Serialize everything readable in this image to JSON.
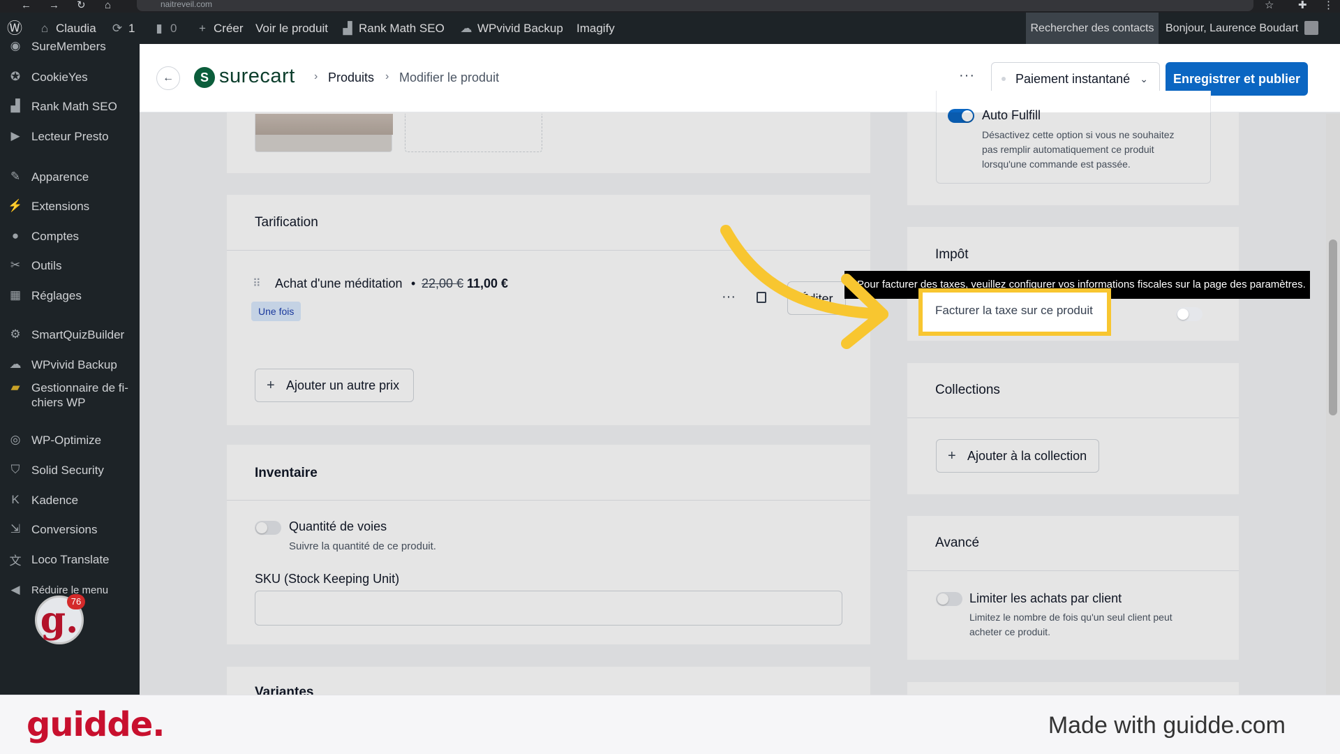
{
  "browser": {
    "url": "naitreveil.com"
  },
  "admin_bar": {
    "site_name": "Claudia",
    "updates_count": "1",
    "comments_count": "0",
    "create": "Créer",
    "view_product": "Voir le produit",
    "rank_math": "Rank Math SEO",
    "wpvivid": "WPvivid Backup",
    "imagify": "Imagify",
    "search_contacts": "Rechercher des contacts",
    "greeting": "Bonjour, Laurence Boudart"
  },
  "sidebar": {
    "items": [
      {
        "label": "SureMembers",
        "icon": "suremembers-icon"
      },
      {
        "label": "CookieYes",
        "icon": "cookie-icon"
      },
      {
        "label": "Rank Math SEO",
        "icon": "chart-icon"
      },
      {
        "label": "Lecteur Presto",
        "icon": "play-icon"
      },
      {
        "label": "Apparence",
        "icon": "brush-icon"
      },
      {
        "label": "Extensions",
        "icon": "plug-icon"
      },
      {
        "label": "Comptes",
        "icon": "user-icon"
      },
      {
        "label": "Outils",
        "icon": "wrench-icon"
      },
      {
        "label": "Réglages",
        "icon": "settings-icon"
      },
      {
        "label": "SmartQuizBuilder",
        "icon": "gear-icon"
      },
      {
        "label": "WPvivid Backup",
        "icon": "cloud-icon"
      },
      {
        "label": "Gestionnaire de fi-",
        "label2": "chiers WP",
        "icon": "folder-icon"
      },
      {
        "label": "WP-Optimize",
        "icon": "optimize-icon"
      },
      {
        "label": "Solid Security",
        "icon": "shield-icon"
      },
      {
        "label": "Kadence",
        "icon": "kadence-icon"
      },
      {
        "label": "Conversions",
        "icon": "conversions-icon"
      },
      {
        "label": "Loco Translate",
        "icon": "translate-icon"
      },
      {
        "label": "Réduire le menu",
        "icon": "collapse-icon"
      }
    ],
    "badge_letter": "g.",
    "badge_count": "76"
  },
  "header": {
    "brand": "surecart",
    "crumb_products": "Produits",
    "crumb_edit": "Modifier le produit",
    "more": "···",
    "payment_select": "Paiement instantané",
    "publish_button": "Enregistrer et publier"
  },
  "pricing": {
    "title": "Tarification",
    "price_name": "Achat d'une méditation",
    "separator": "•",
    "old_price": "22,00 €",
    "new_price": "11,00 €",
    "tag": "Une fois",
    "edit_button": "Éditer",
    "add_price": "Ajouter un autre prix"
  },
  "inventory": {
    "title": "Inventaire",
    "track_label": "Quantité de voies",
    "track_help": "Suivre la quantité de ce produit.",
    "sku_label": "SKU (Stock Keeping Unit)",
    "sku_value": ""
  },
  "variants": {
    "title": "Variantes"
  },
  "fulfill": {
    "label": "Auto Fulfill",
    "help1": "Désactivez cette option si vous ne souhaitez",
    "help2": "pas remplir automatiquement ce produit",
    "help3": "lorsqu'une commande est passée."
  },
  "tax": {
    "title": "Impôt",
    "tooltip": "Pour facturer des taxes, veuillez configurer vos informations fiscales sur la page des paramètres.",
    "charge_label": "Facturer la taxe sur ce produit"
  },
  "collections": {
    "title": "Collections",
    "add_button": "Ajouter à la collection"
  },
  "advanced": {
    "title": "Avancé",
    "limit_label": "Limiter les achats par client",
    "limit_help1": "Limitez le nombre de fois qu'un seul client peut",
    "limit_help2": "acheter ce produit."
  },
  "footer": {
    "logo": "guidde.",
    "made_with": "Made with guidde.com"
  },
  "colors": {
    "wp_dark": "#1d2327",
    "primary": "#0b66c2",
    "highlight": "#f8c630",
    "guidde_red": "#c8102e"
  }
}
